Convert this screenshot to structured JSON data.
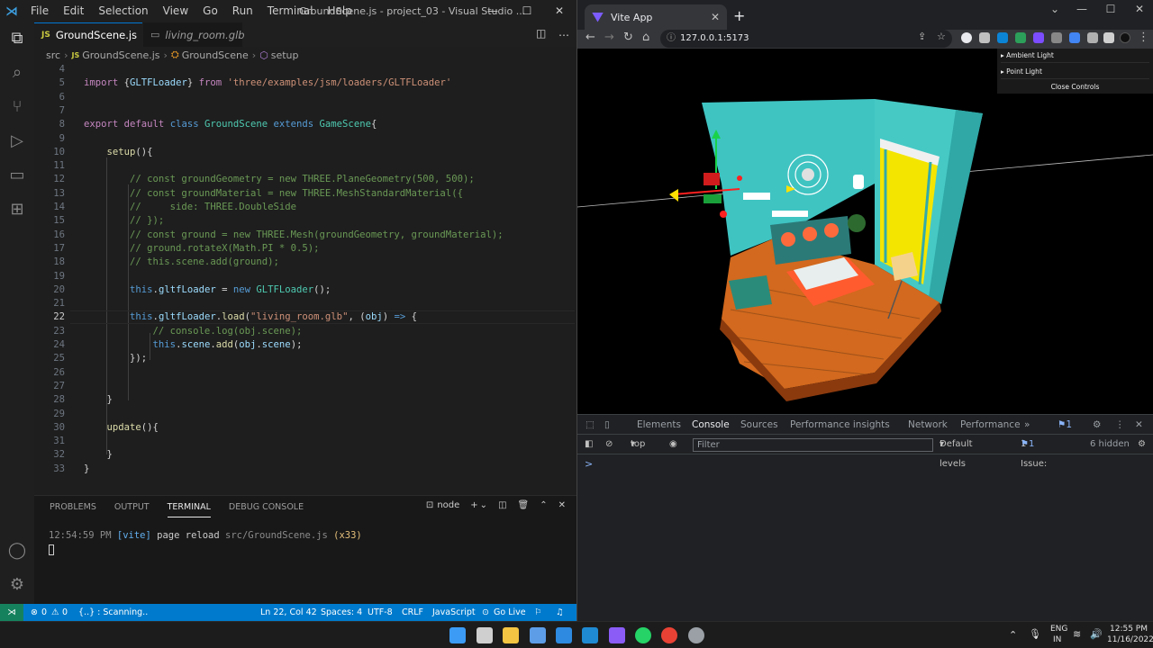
{
  "vscode": {
    "menu": [
      "File",
      "Edit",
      "Selection",
      "View",
      "Go",
      "Run",
      "Terminal",
      "Help"
    ],
    "window_title": "GroundScene.js - project_03 - Visual Studio ...",
    "tabs": [
      {
        "label": "GroundScene.js",
        "icon": "JS",
        "active": true
      },
      {
        "label": "living_room.glb",
        "icon": "file-icon",
        "active": false
      }
    ],
    "breadcrumb": [
      "src",
      "GroundScene.js",
      "GroundScene",
      "setup"
    ],
    "current_line": 22,
    "code_lines": [
      {
        "n": "4",
        "tokens": []
      },
      {
        "n": "5",
        "tokens": [
          [
            "kw2",
            "import "
          ],
          [
            "pn",
            "{"
          ],
          [
            "var",
            "GLTFLoader"
          ],
          [
            "pn",
            "} "
          ],
          [
            "kw2",
            "from "
          ],
          [
            "str",
            "'three/examples/jsm/loaders/GLTFLoader'"
          ]
        ]
      },
      {
        "n": "6",
        "tokens": []
      },
      {
        "n": "7",
        "tokens": []
      },
      {
        "n": "8",
        "tokens": [
          [
            "kw2",
            "export "
          ],
          [
            "kw2",
            "default "
          ],
          [
            "kw",
            "class "
          ],
          [
            "cls",
            "GroundScene "
          ],
          [
            "kw",
            "extends "
          ],
          [
            "cls",
            "GameScene"
          ],
          [
            "pn",
            "{"
          ]
        ]
      },
      {
        "n": "9",
        "tokens": []
      },
      {
        "n": "10",
        "tokens": [
          [
            "pn",
            "    "
          ],
          [
            "fn",
            "setup"
          ],
          [
            "pn",
            "(){"
          ]
        ]
      },
      {
        "n": "11",
        "tokens": []
      },
      {
        "n": "12",
        "tokens": [
          [
            "cm",
            "        // const groundGeometry = new THREE.PlaneGeometry(500, 500);"
          ]
        ]
      },
      {
        "n": "13",
        "tokens": [
          [
            "cm",
            "        // const groundMaterial = new THREE.MeshStandardMaterial({"
          ]
        ]
      },
      {
        "n": "14",
        "tokens": [
          [
            "cm",
            "        //     side: THREE.DoubleSide"
          ]
        ]
      },
      {
        "n": "15",
        "tokens": [
          [
            "cm",
            "        // });"
          ]
        ]
      },
      {
        "n": "16",
        "tokens": [
          [
            "cm",
            "        // const ground = new THREE.Mesh(groundGeometry, groundMaterial);"
          ]
        ]
      },
      {
        "n": "17",
        "tokens": [
          [
            "cm",
            "        // ground.rotateX(Math.PI * 0.5);"
          ]
        ]
      },
      {
        "n": "18",
        "tokens": [
          [
            "cm",
            "        // this.scene.add(ground);"
          ]
        ]
      },
      {
        "n": "19",
        "tokens": []
      },
      {
        "n": "20",
        "tokens": [
          [
            "pn",
            "        "
          ],
          [
            "kw",
            "this"
          ],
          [
            "pn",
            "."
          ],
          [
            "var",
            "gltfLoader"
          ],
          [
            "pn",
            " = "
          ],
          [
            "kw",
            "new "
          ],
          [
            "cls",
            "GLTFLoader"
          ],
          [
            "pn",
            "();"
          ]
        ]
      },
      {
        "n": "21",
        "tokens": []
      },
      {
        "n": "22",
        "tokens": [
          [
            "pn",
            "        "
          ],
          [
            "kw",
            "this"
          ],
          [
            "pn",
            "."
          ],
          [
            "var",
            "gltfLoader"
          ],
          [
            "pn",
            "."
          ],
          [
            "fn",
            "load"
          ],
          [
            "pn",
            "("
          ],
          [
            "str",
            "\"living_room.glb\""
          ],
          [
            "pn",
            ", ("
          ],
          [
            "var",
            "obj"
          ],
          [
            "pn",
            ") "
          ],
          [
            "kw",
            "=> "
          ],
          [
            "pn",
            "{"
          ]
        ]
      },
      {
        "n": "23",
        "tokens": [
          [
            "cm",
            "            // console.log(obj.scene);"
          ]
        ]
      },
      {
        "n": "24",
        "tokens": [
          [
            "pn",
            "            "
          ],
          [
            "kw",
            "this"
          ],
          [
            "pn",
            "."
          ],
          [
            "var",
            "scene"
          ],
          [
            "pn",
            "."
          ],
          [
            "fn",
            "add"
          ],
          [
            "pn",
            "("
          ],
          [
            "var",
            "obj"
          ],
          [
            "pn",
            "."
          ],
          [
            "var",
            "scene"
          ],
          [
            "pn",
            ");"
          ]
        ]
      },
      {
        "n": "25",
        "tokens": [
          [
            "pn",
            "        });"
          ]
        ]
      },
      {
        "n": "26",
        "tokens": []
      },
      {
        "n": "27",
        "tokens": []
      },
      {
        "n": "28",
        "tokens": [
          [
            "pn",
            "    }"
          ]
        ]
      },
      {
        "n": "29",
        "tokens": []
      },
      {
        "n": "30",
        "tokens": [
          [
            "pn",
            "    "
          ],
          [
            "fn",
            "update"
          ],
          [
            "pn",
            "(){"
          ]
        ]
      },
      {
        "n": "31",
        "tokens": []
      },
      {
        "n": "32",
        "tokens": [
          [
            "pn",
            "    }"
          ]
        ]
      },
      {
        "n": "33",
        "tokens": [
          [
            "pn",
            "}"
          ]
        ]
      }
    ],
    "panel": {
      "tabs": [
        "PROBLEMS",
        "OUTPUT",
        "TERMINAL",
        "DEBUG CONSOLE"
      ],
      "active_tab": "TERMINAL",
      "shell": "node",
      "terminal": {
        "time": "12:54:59 PM",
        "tag": "[vite]",
        "msg": "page reload",
        "file": "src/GroundScene.js",
        "count": "(x33)"
      }
    },
    "status": {
      "errors": "0",
      "warnings": "0",
      "scanning": "{..} : Scanning..",
      "position": "Ln 22, Col 42",
      "spaces": "Spaces: 4",
      "encoding": "UTF-8",
      "eol": "CRLF",
      "language": "JavaScript",
      "golive": "Go Live"
    }
  },
  "browser": {
    "tab_title": "Vite App",
    "url": "127.0.0.1:5173",
    "gui": {
      "items": [
        "Ambient Light",
        "Point Light"
      ],
      "close": "Close Controls"
    },
    "devtools": {
      "tabs": [
        "Elements",
        "Console",
        "Sources",
        "Performance insights",
        "Network",
        "Performance"
      ],
      "active_tab": "Console",
      "badge": "1",
      "context": "top",
      "filter_placeholder": "Filter",
      "levels": "Default levels",
      "issues_label": "1 Issue:",
      "issues_count": "1",
      "hidden": "6 hidden",
      "prompt": ">"
    }
  },
  "taskbar": {
    "lang": "ENG",
    "region": "IN",
    "time": "12:55 PM",
    "date": "11/16/2022"
  }
}
